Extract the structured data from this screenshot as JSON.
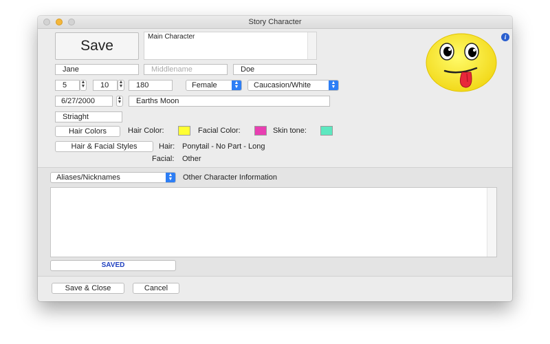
{
  "window": {
    "title": "Story Character"
  },
  "main": {
    "save_label": "Save",
    "role": "Main Character",
    "first_name": "Jane",
    "middle_name_placeholder": "Middlename",
    "last_name": "Doe",
    "height_feet": "5",
    "height_inches": "10",
    "weight": "180",
    "gender": "Female",
    "ethnicity": "Caucasion/White",
    "birthdate": "6/27/2000",
    "birthplace": "Earths Moon",
    "orientation": "Striaght",
    "hair_colors_button": "Hair Colors",
    "hair_color_label": "Hair Color:",
    "facial_color_label": "Facial Color:",
    "skin_tone_label": "Skin tone:",
    "hair_styles_button": "Hair & Facial Styles",
    "hair_label": "Hair:",
    "hair_value": "Ponytail - No Part - Long",
    "facial_label": "Facial:",
    "facial_value": "Other"
  },
  "colors": {
    "hair_color": "#ffff33",
    "facial_color": "#e83fb2",
    "skin_tone": "#5de8c0",
    "accent": "#2d7ef5"
  },
  "info_section": {
    "selector": "Aliases/Nicknames",
    "heading": "Other Character Information",
    "text": "",
    "status": "SAVED"
  },
  "footer": {
    "save_close": "Save & Close",
    "cancel": "Cancel"
  }
}
